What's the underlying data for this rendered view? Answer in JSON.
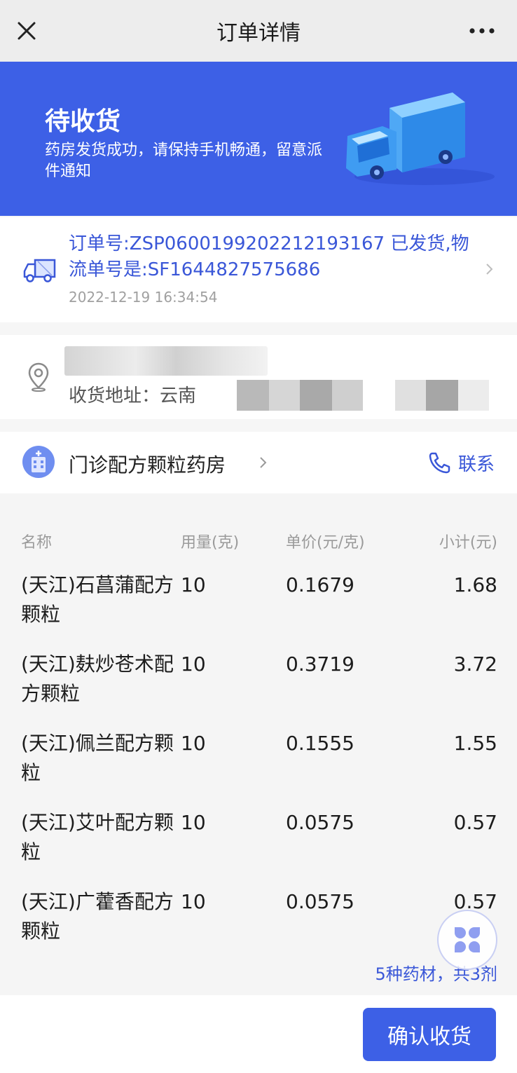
{
  "header": {
    "title": "订单详情",
    "close_icon": "close-icon",
    "more_icon": "more-icon"
  },
  "banner": {
    "status": "待收货",
    "description": "药房发货成功，请保持手机畅通，留意派件通知",
    "bg_color": "#3d60e6",
    "illustration": "delivery-truck-illustration"
  },
  "shipping": {
    "text": "订单号:ZSP0600199202212193167 已发货,物流单号是:SF1644827575686",
    "time": "2022-12-19 16:34:54",
    "icon": "truck-icon"
  },
  "address": {
    "line_prefix": "收货地址：云南",
    "icon": "location-pin-icon"
  },
  "pharmacy": {
    "name": "门诊配方颗粒药房",
    "contact_label": "联系",
    "contact_icon": "phone-icon"
  },
  "table": {
    "headers": {
      "name": "名称",
      "qty": "用量(克)",
      "price": "单价(元/克)",
      "subtotal": "小计(元)"
    },
    "rows": [
      {
        "name": "(天江)石菖蒲配方颗粒",
        "qty": "10",
        "price": "0.1679",
        "subtotal": "1.68"
      },
      {
        "name": "(天江)麸炒苍术配方颗粒",
        "qty": "10",
        "price": "0.3719",
        "subtotal": "3.72"
      },
      {
        "name": "(天江)佩兰配方颗粒",
        "qty": "10",
        "price": "0.1555",
        "subtotal": "1.55"
      },
      {
        "name": "(天江)艾叶配方颗粒",
        "qty": "10",
        "price": "0.0575",
        "subtotal": "0.57"
      },
      {
        "name": "(天江)广藿香配方颗粒",
        "qty": "10",
        "price": "0.0575",
        "subtotal": "0.57"
      }
    ],
    "summary": "5种药材，共3剂"
  },
  "actions": {
    "confirm_label": "确认收货",
    "accent_color": "#3d60e6"
  }
}
